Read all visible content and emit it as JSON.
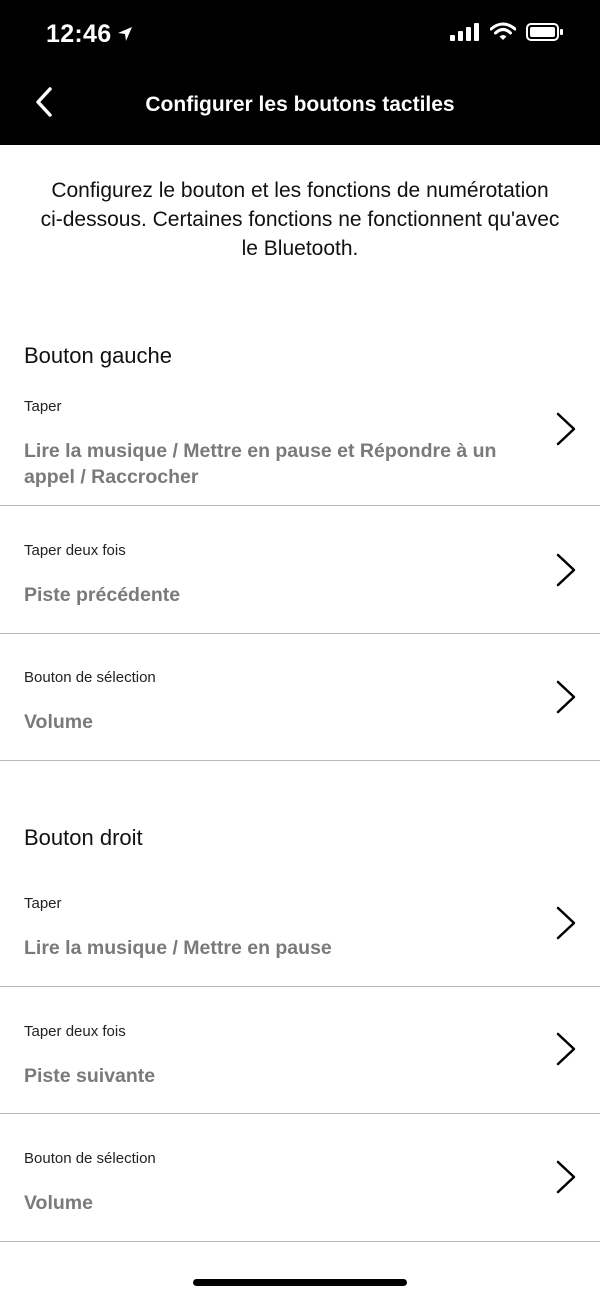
{
  "status_bar": {
    "time": "12:46",
    "icons": [
      "location-arrow-icon",
      "signal-icon",
      "wifi-icon",
      "battery-icon"
    ]
  },
  "nav": {
    "title": "Configurer les boutons tactiles",
    "back_icon": "chevron-left-icon"
  },
  "intro": "Configurez le bouton et les fonctions de numérotation ci-dessous. Certaines fonctions ne fonctionnent qu'avec le Bluetooth.",
  "sections": [
    {
      "title": "Bouton gauche",
      "rows": [
        {
          "label": "Taper",
          "value": "Lire la musique / Mettre en pause et Répondre à un appel / Raccrocher"
        },
        {
          "label": "Taper deux fois",
          "value": "Piste précédente"
        },
        {
          "label": "Bouton de sélection",
          "value": "Volume"
        }
      ]
    },
    {
      "title": "Bouton droit",
      "rows": [
        {
          "label": "Taper",
          "value": "Lire la musique / Mettre en pause"
        },
        {
          "label": "Taper deux fois",
          "value": "Piste suivante"
        },
        {
          "label": "Bouton de sélection",
          "value": "Volume"
        }
      ]
    }
  ],
  "colors": {
    "header_bg": "#000000",
    "value_text": "#7a7a7a",
    "divider": "#b9b9b9"
  }
}
